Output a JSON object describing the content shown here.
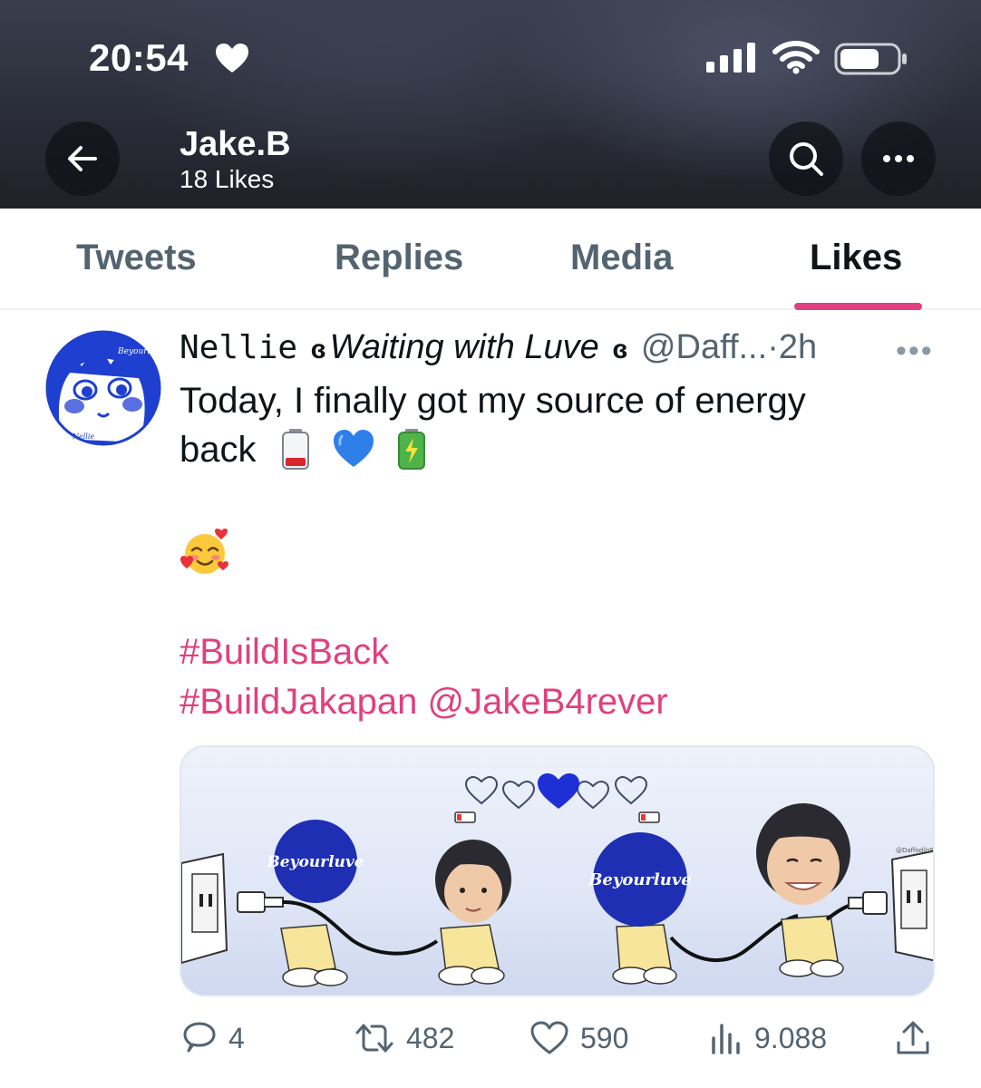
{
  "status_bar": {
    "time": "20:54"
  },
  "header": {
    "name": "Jake.B",
    "subtitle": "18 Likes"
  },
  "tabs": [
    {
      "label": "Tweets",
      "active": false
    },
    {
      "label": "Replies",
      "active": false
    },
    {
      "label": "Media",
      "active": false
    },
    {
      "label": "Likes",
      "active": true
    }
  ],
  "colors": {
    "accent": "#e0407f",
    "secondary_text": "#536471",
    "primary_text": "#0f1419"
  },
  "tweet": {
    "author_name": "Nellie",
    "author_deco_left": "ɞ",
    "author_tagline": "Waiting with Luve",
    "author_deco_right": "ɞ",
    "handle": "@Daff...",
    "separator": "·",
    "time": "2h",
    "more_icon": "ellipsis-icon",
    "text_line1": "Today, I finally got my source of energy",
    "text_line2": "back",
    "hashtags": [
      "#BuildIsBack",
      "#BuildJakapan"
    ],
    "mention": "@JakeB4rever",
    "avatar_text_top": "Beyourluve",
    "avatar_text_bottom": "Nellie",
    "media": {
      "label_left": "Beyourluve",
      "label_right": "Beyourluve",
      "watermark": "@DaffodilsBuild"
    },
    "actions": {
      "replies": "4",
      "retweets": "482",
      "likes": "590",
      "views": "9.088"
    }
  }
}
